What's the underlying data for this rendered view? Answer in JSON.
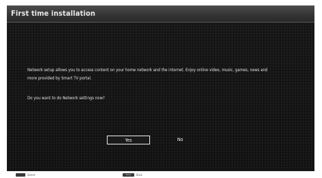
{
  "title_bar": {
    "title": "First time installation"
  },
  "message": {
    "paragraph_line1": "Network setup allows you to access content on your home network and the internet. Enjoy online video, music, games, news and",
    "paragraph_line2": "more provided by Smart TV portal.",
    "question": "Do you want to do Network settings now?"
  },
  "buttons": {
    "yes_label": "Yes",
    "no_label": "No",
    "selected": "Yes"
  },
  "footer": {
    "select_key": "",
    "select_label": "Select",
    "back_key": "BACK",
    "back_label": "Back"
  },
  "colors": {
    "background": "#151515",
    "title_bar": "#3a3a3a",
    "text": "#e6e6e6",
    "focus_border": "#eeeeee"
  }
}
